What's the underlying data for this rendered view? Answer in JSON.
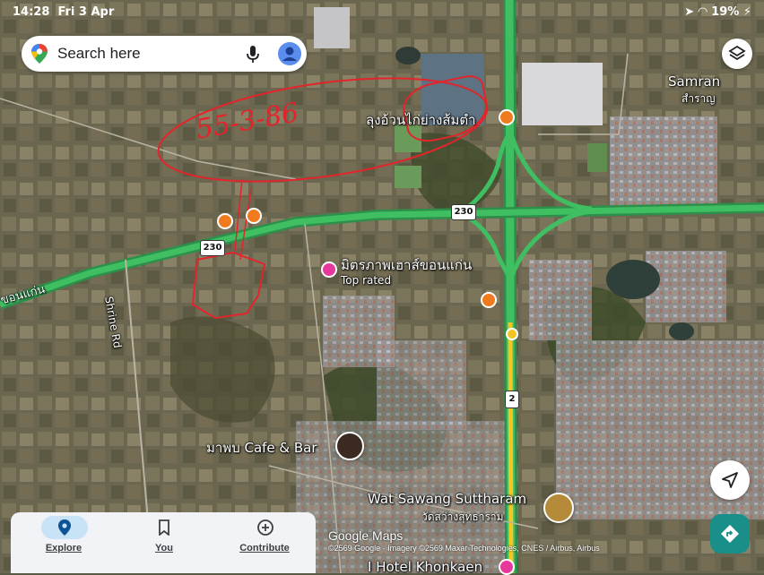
{
  "status_bar": {
    "time": "14:28",
    "date": "Fri 3 Apr",
    "battery": "19%"
  },
  "search": {
    "placeholder": "Search here"
  },
  "map_labels": {
    "samran_en": "Samran",
    "samran_th": "สำราญ",
    "restaurant": "ลุงอ้วนไก่ย่างส้มตำ",
    "mittraphap": "มิตรภาพเฮาส์ขอนแก่น",
    "top_rated": "Top rated",
    "khon_kaen_road": "ขอนแก่น",
    "shrine_rd": "Shrine Rd",
    "cafe": "มาพบ Cafe & Bar",
    "wat_en": "Wat Sawang Suttharam",
    "wat_th": "วัดสว่างสุทธาราม",
    "hotel": "I Hotel Khonkaen"
  },
  "road_shields": {
    "r230_a": "230",
    "r230_b": "230",
    "r2": "2"
  },
  "annotation": {
    "handwritten": "55-3-86"
  },
  "bottom_nav": {
    "explore": "Explore",
    "you": "You",
    "contribute": "Contribute"
  },
  "attribution": {
    "logo": "Google Maps",
    "copyright": "©2569 Google · Imagery ©2569 Maxar Technologies, CNES / Airbus, Airbus"
  },
  "colors": {
    "road_green": "#3fbf62",
    "highway_yellow": "#f3c623",
    "annotation_red": "#e3242b",
    "directions_teal": "#1a8f8a"
  }
}
